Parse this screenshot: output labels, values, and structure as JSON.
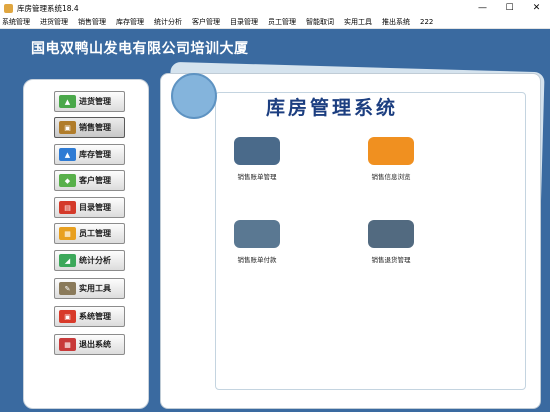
{
  "window": {
    "title": "库房管理系统18.4",
    "controls": [
      "—",
      "☐",
      "✕"
    ]
  },
  "menu": {
    "items": [
      "系统管理",
      "进货管理",
      "销售管理",
      "库存管理",
      "统计分析",
      "客户管理",
      "目录管理",
      "员工管理",
      "智能取词",
      "实用工具",
      "推出系统",
      "222"
    ]
  },
  "header": {
    "company": "国电双鸭山发电有限公司培训大厦"
  },
  "sidebar": {
    "buttons": [
      {
        "label": "进货管理",
        "color": "#4aa84a",
        "glyph": "▲"
      },
      {
        "label": "销售管理",
        "color": "#b07c2a",
        "glyph": "▣"
      },
      {
        "label": "库存管理",
        "color": "#2e7bd4",
        "glyph": "▲"
      },
      {
        "label": "客户管理",
        "color": "#58b04a",
        "glyph": "◆"
      },
      {
        "label": "目录管理",
        "color": "#d43a2a",
        "glyph": "▤"
      },
      {
        "label": "员工管理",
        "color": "#e8a020",
        "glyph": "▦"
      },
      {
        "label": "统计分析",
        "color": "#3ca85a",
        "glyph": "◢"
      },
      {
        "label": "实用工具",
        "color": "#8a7a5a",
        "glyph": "✎"
      },
      {
        "label": "系统管理",
        "color": "#d83a2a",
        "glyph": "▣"
      },
      {
        "label": "退出系统",
        "color": "#c83a3a",
        "glyph": "▦"
      }
    ]
  },
  "content": {
    "system_title": "库房管理系统",
    "functions": [
      {
        "label": "销售账单管理",
        "color": "#4a6a8a",
        "icon": "tiles-icon"
      },
      {
        "label": "销售信息浏览",
        "color": "#f09020",
        "icon": "rss-icon"
      },
      {
        "label": "销售账单付款",
        "color": "#5a7892",
        "icon": "box-tray-icon"
      },
      {
        "label": "销售退货管理",
        "color": "#526a80",
        "icon": "open-box-icon"
      }
    ]
  }
}
